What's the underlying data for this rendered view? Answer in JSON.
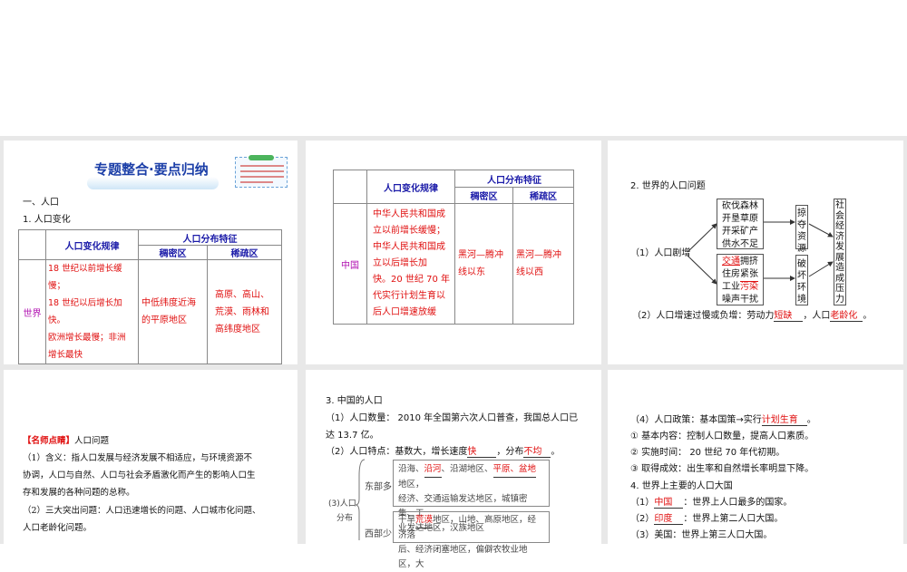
{
  "slide1": {
    "title": "专题整合·要点归纳",
    "section": "一、人口",
    "subsection": "1. 人口变化",
    "table": {
      "col_rule": "人口变化规律",
      "col_dist": "人口分布特征",
      "col_dense": "稠密区",
      "col_sparse": "稀疏区",
      "row_label": "世界",
      "rule_lines": [
        "18 世纪以前增长缓慢；",
        "18 世纪以后增长加快。",
        "欧洲增长最慢；非洲",
        "增长最快"
      ],
      "dense_lines": [
        "中低纬度近海",
        "的平原地区"
      ],
      "sparse_lines": [
        "高原、高山、",
        "荒漠、雨林和",
        "高纬度地区"
      ]
    }
  },
  "slide2": {
    "table": {
      "col_rule": "人口变化规律",
      "col_dist": "人口分布特征",
      "col_dense": "稠密区",
      "col_sparse": "稀疏区",
      "row_label": "中国",
      "rule_lines": [
        "中华人民共和国成",
        "立以前增长缓慢；",
        "中华人民共和国成",
        "立以后增长加",
        "快。20 世纪 70 年",
        "代实行计划生育以",
        "后人口增速放缓"
      ],
      "dense_lines": [
        "黑河—腾冲",
        "线以东"
      ],
      "sparse_lines": [
        "黑河—腾冲",
        "线以西"
      ]
    }
  },
  "slide3": {
    "heading": "2. 世界的人口问题",
    "root": "（1）人口剧增",
    "box1": [
      "砍伐森林",
      "开垦草原",
      "开采矿产",
      "供水不足"
    ],
    "box2_l1a": "交通",
    "box2_l1b": "拥挤",
    "box2_l2": "住房紧张",
    "box2_l3a": "工业",
    "box2_l3b": "污染",
    "box2_l4": "噪声干扰",
    "box3": [
      "掠",
      "夺",
      "资",
      "源"
    ],
    "box4": [
      "破",
      "坏",
      "环",
      "境"
    ],
    "box5": [
      "社",
      "会",
      "经",
      "济",
      "发",
      "展",
      "造",
      "成",
      "压",
      "力"
    ],
    "line2_a": "（2）人口增速过慢或负增：劳动力",
    "line2_b": "短缺",
    "line2_c": "，人口",
    "line2_d": "老龄化",
    "line2_e": "。"
  },
  "slide4": {
    "tag": "【名师点睛】",
    "tag_rest": "人口问题",
    "lines": [
      "（1）含义：指人口发展与经济发展不相适应，与环境资源不",
      "协调，人口与自然、人口与社会矛盾激化而产生的影响人口生",
      "存和发展的各种问题的总称。",
      "（2）三大突出问题：人口迅速增长的问题、人口城市化问题、",
      "人口老龄化问题。"
    ]
  },
  "slide5": {
    "heading": "3. 中国的人口",
    "l1": "（1）人口数量： 2010 年全国第六次人口普查，我国总人口已",
    "l2": "达 13.7 亿。",
    "l3a": "（2）人口特点：基数大，增长速度",
    "l3b": "快",
    "l3c": "，分布",
    "l3d": "不均",
    "l3e": "。",
    "dist_label1": "(3)人口",
    "dist_label2": "分布",
    "east": "东部多",
    "west": "西部少",
    "east_1a": "沿海、",
    "east_1b": "沿河",
    "east_1c": "、沿湖地区、",
    "east_1d": "平原、盆地",
    "east_1e": "地区，",
    "east_2": "经济、交通运输发达地区，城镇密集、工",
    "east_3": "业发达地区，汉族地区",
    "west_1a": "干旱",
    "west_1b": "荒漠",
    "west_1c": "地区，山地、高原地区，经济落",
    "west_2": "后、经济闭塞地区，偏僻农牧业地区，大"
  },
  "slide6": {
    "l1a": "（4）人口政策：基本国策→实行",
    "l1b": "计划生育",
    "l1c": "。",
    "l2": "① 基本内容：控制人口数量，提高人口素质。",
    "l3": "② 实施时间： 20 世纪 70 年代初期。",
    "l4": "③ 取得成效：出生率和自然增长率明显下降。",
    "l5": "4. 世界上主要的人口大国",
    "l6a": "（1）",
    "l6b": "中国",
    "l6c": "：世界上人口最多的国家。",
    "l7a": "（2）",
    "l7b": "印度",
    "l7c": "：世界上第二人口大国。",
    "l8": "（3）美国：世界上第三人口大国。"
  }
}
